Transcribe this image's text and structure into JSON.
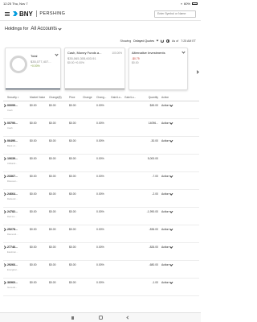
{
  "status_bar": {
    "time": "12:25",
    "date": "Thu, Nov 7",
    "battery": "60%"
  },
  "nav": {
    "logo": "BNY",
    "logo_sub": "PERSHING",
    "search_placeholder": "Enter Symbol or Name"
  },
  "holdings": {
    "label": "Holdings for",
    "account": "All Accounts"
  },
  "showing": {
    "label": "Showing",
    "value": "Delayed Quotes",
    "asof": "As of",
    "time": "7:25 AM ET"
  },
  "cards": [
    {
      "title": "Total",
      "value": "$35,077,407...",
      "pct": "+0.00%",
      "amt": ""
    },
    {
      "title": "Cash, Money Funds a...",
      "tag": "100.00%",
      "value": "$35,065,305,603.91",
      "pct": "+0.00%",
      "amt": "$0.00"
    },
    {
      "title": "Alternative Investments",
      "tag": "",
      "value": "-$0.79",
      "pct": "",
      "amt": "$0.00"
    }
  ],
  "table": {
    "headers": {
      "security": "Security",
      "market_value": "Market Value",
      "change_dollar": "Change($)",
      "price": "Price",
      "change": "Change",
      "change_pct": "Chang...",
      "gain_loss": "Gain/Lo...",
      "gain_pct": "Gain/Lo...",
      "quantity": "Quantity",
      "action": "Action"
    },
    "rows": [
      {
        "symbol": "00099...",
        "desc": "Cash",
        "mv": "$0.00",
        "chd": "$0.00",
        "price": "$0.00",
        "chg": "",
        "chp": "0.00%",
        "gl": "",
        "gp": "",
        "qty": "$45.00",
        "action": "Action"
      },
      {
        "symbol": "00790...",
        "desc": "Cash",
        "mv": "$0.00",
        "chd": "$0.00",
        "price": "$0.00",
        "chg": "",
        "chp": "0.00%",
        "gl": "",
        "gp": "",
        "qty": "14096...",
        "action": "Action"
      },
      {
        "symbol": "06490...",
        "desc": "Bank of...",
        "mv": "$0.00",
        "chd": "$0.00",
        "price": "$0.00",
        "chg": "",
        "chp": "0.00%",
        "gl": "",
        "gp": "",
        "qty": "-30.00",
        "action": "Action"
      },
      {
        "symbol": "10639...",
        "desc": "Citibank...",
        "mv": "$0.00",
        "chd": "$0.00",
        "price": "$0.00",
        "chg": "",
        "chp": "0.00%",
        "gl": "",
        "gp": "",
        "qty": "5,000.00",
        "action": ""
      },
      {
        "symbol": "23367...",
        "desc": "Discover...",
        "mv": "$0.00",
        "chd": "$0.00",
        "price": "$0.00",
        "chg": "",
        "chp": "0.00%",
        "gl": "",
        "gp": "",
        "qty": "-7.00",
        "action": "Action"
      },
      {
        "symbol": "24664...",
        "desc": "Delta Air...",
        "mv": "$0.00",
        "chd": "$0.00",
        "price": "$0.00",
        "chg": "",
        "chp": "0.00%",
        "gl": "",
        "gp": "",
        "qty": "-2.00",
        "action": "Action"
      },
      {
        "symbol": "24782...",
        "desc": "Dell Inc...",
        "mv": "$0.00",
        "chd": "$0.00",
        "price": "$0.00",
        "chg": "",
        "chp": "0.00%",
        "gl": "",
        "gp": "",
        "qty": "-1,990.00",
        "action": "Action"
      },
      {
        "symbol": "25278...",
        "desc": "Diamond...",
        "mv": "$0.00",
        "chd": "$0.00",
        "price": "$0.00",
        "chg": "",
        "chp": "0.00%",
        "gl": "",
        "gp": "",
        "qty": "-836.00",
        "action": "Action"
      },
      {
        "symbol": "27746...",
        "desc": "Eastman...",
        "mv": "$0.00",
        "chd": "$0.00",
        "price": "$0.00",
        "chg": "",
        "chp": "0.00%",
        "gl": "",
        "gp": "",
        "qty": "-826.00",
        "action": "Action"
      },
      {
        "symbol": "29266...",
        "desc": "Energizer...",
        "mv": "$0.00",
        "chd": "$0.00",
        "price": "$0.00",
        "chg": "",
        "chp": "0.00%",
        "gl": "",
        "gp": "",
        "qty": "-680.00",
        "action": "Action"
      },
      {
        "symbol": "36960...",
        "desc": "General...",
        "mv": "$0.00",
        "chd": "$0.00",
        "price": "$0.00",
        "chg": "",
        "chp": "0.00%",
        "gl": "",
        "gp": "",
        "qty": "-1.00",
        "action": "Action"
      }
    ]
  }
}
